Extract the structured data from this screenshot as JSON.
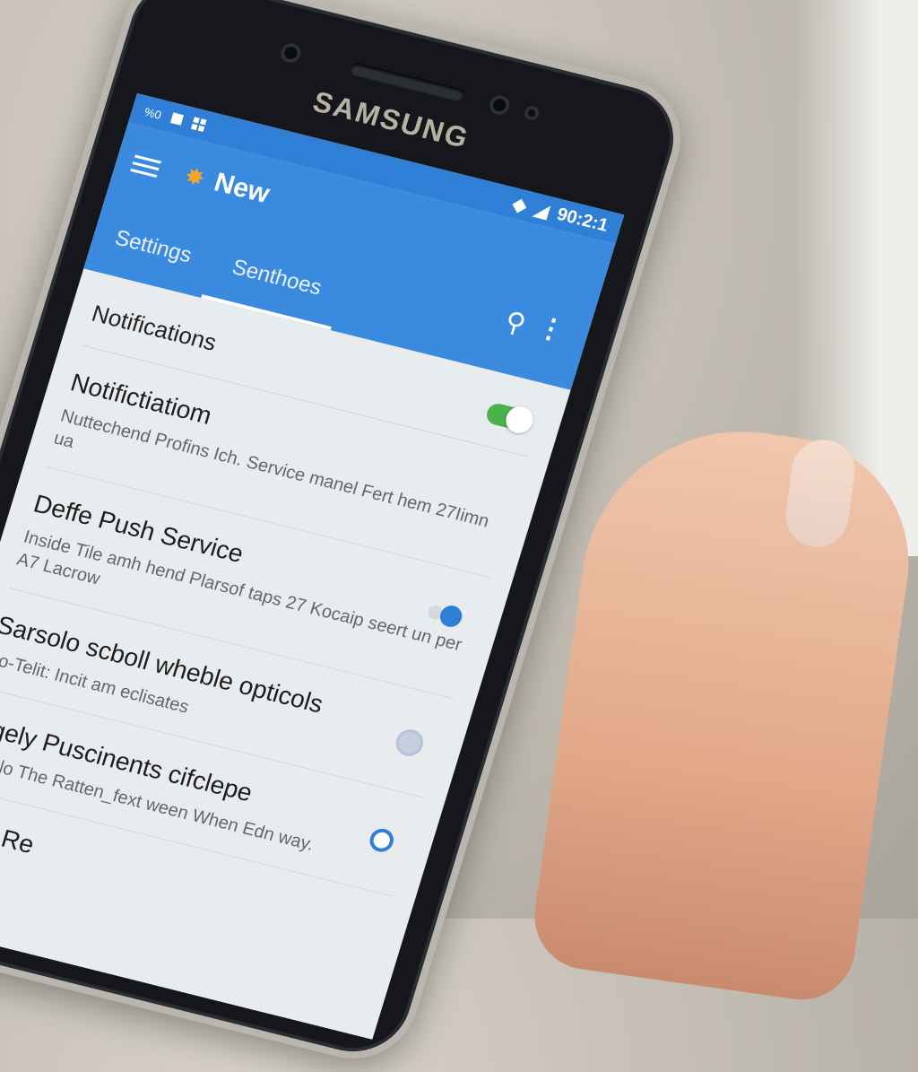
{
  "device": {
    "brand": "SAMSUNG"
  },
  "status_bar": {
    "left_text": "%0",
    "time": "90:2:1"
  },
  "app_bar": {
    "title": "New",
    "tabs": [
      {
        "label": "Settings"
      },
      {
        "label": "Senthoes",
        "active": true
      }
    ]
  },
  "list": {
    "section_title": "Notifications",
    "items": [
      {
        "title": "Notifictiatiom",
        "subtitle": "Nuttechend Profins Ich. Service manel Fert hem 27Iimn ua"
      },
      {
        "title": "Deffe Push Service",
        "subtitle": "Inside Tile amh hend Plarsof taps 27 Kocaip seert un per A7 Lacrow"
      },
      {
        "title": "Sarsolo scboll wheble opticols",
        "subtitle": "So-Telit: Incit am eclisates"
      },
      {
        "title": "Ilcgely Puscinents cifclepe",
        "subtitle": "Gunglo The Ratten_fext ween When Edn way."
      }
    ],
    "footer_partial": "tently Re"
  },
  "colors": {
    "accent": "#3a8ae0",
    "toggle_on": "#4cb24a",
    "radio": "#2f7fd6"
  }
}
